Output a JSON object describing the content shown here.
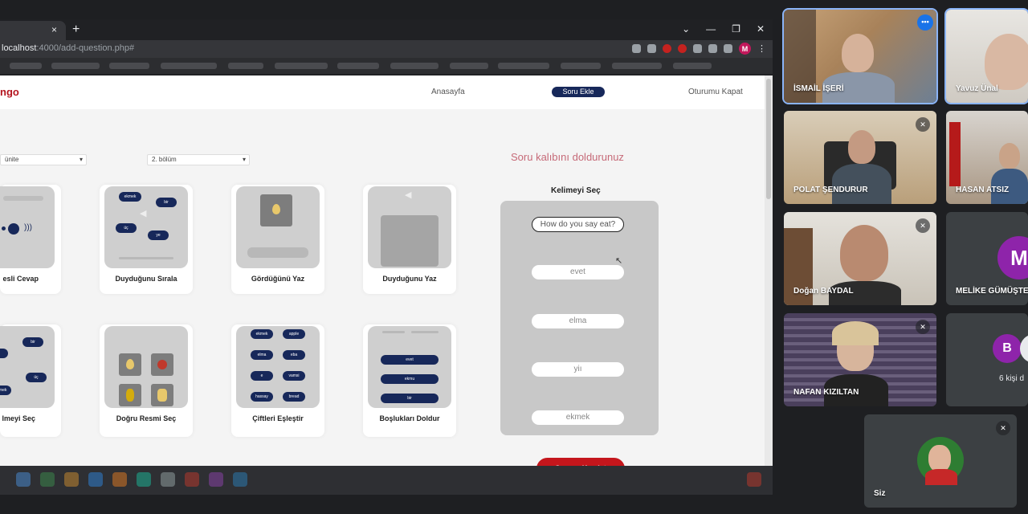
{
  "browser": {
    "url_host": "localhost",
    "url_path": ":4000/add-question.php#",
    "tab_close": "×",
    "new_tab": "+",
    "profile_initial": "M"
  },
  "site": {
    "logo": "ngo",
    "nav": [
      "Anasayfa",
      "Soru Ekle",
      "Oturumu Kapat"
    ]
  },
  "filters": {
    "unit": "ünite",
    "section": "2. bölüm"
  },
  "question_types": [
    "esli Cevap",
    "Duyduğunu Sırala",
    "Gördüğünü Yaz",
    "Duyduğunu Yaz",
    "lmeyi Seç",
    "Doğru Resmi Seç",
    "Çiftleri Eşleştir",
    "Boşlukları Doldur"
  ],
  "form": {
    "title": "Soru kalıbını doldurunuz",
    "subtitle": "Kelimeyi Seç",
    "question": "How do you say eat?",
    "answers": [
      "evet",
      "elma",
      "yiı",
      "ekmek"
    ],
    "save": "Soruyu Kaydet"
  },
  "meeting": {
    "participants": [
      {
        "name": "İSMAİL İŞERİ",
        "muted": false,
        "active": true
      },
      {
        "name": "Yavuz Ünal",
        "muted": false,
        "active": true
      },
      {
        "name": "POLAT ŞENDURUR",
        "muted": true,
        "active": false
      },
      {
        "name": "HASAN ATSIZ",
        "muted": false,
        "active": false
      },
      {
        "name": "Doğan BAYDAL",
        "muted": true,
        "active": false
      },
      {
        "name": "MELİKE GÜMÜŞTE",
        "muted": false,
        "active": false,
        "initial": "M"
      },
      {
        "name": "NAFAN KIZILTAN",
        "muted": true,
        "active": false
      }
    ],
    "others": {
      "initials": [
        "B"
      ],
      "label": "6 kişi d"
    },
    "self": {
      "name": "Siz"
    }
  },
  "colors": {
    "brand_red": "#c4161c",
    "navy": "#17285a",
    "meet_bg": "#1e1f22",
    "active_outline": "#8ab4f8"
  }
}
